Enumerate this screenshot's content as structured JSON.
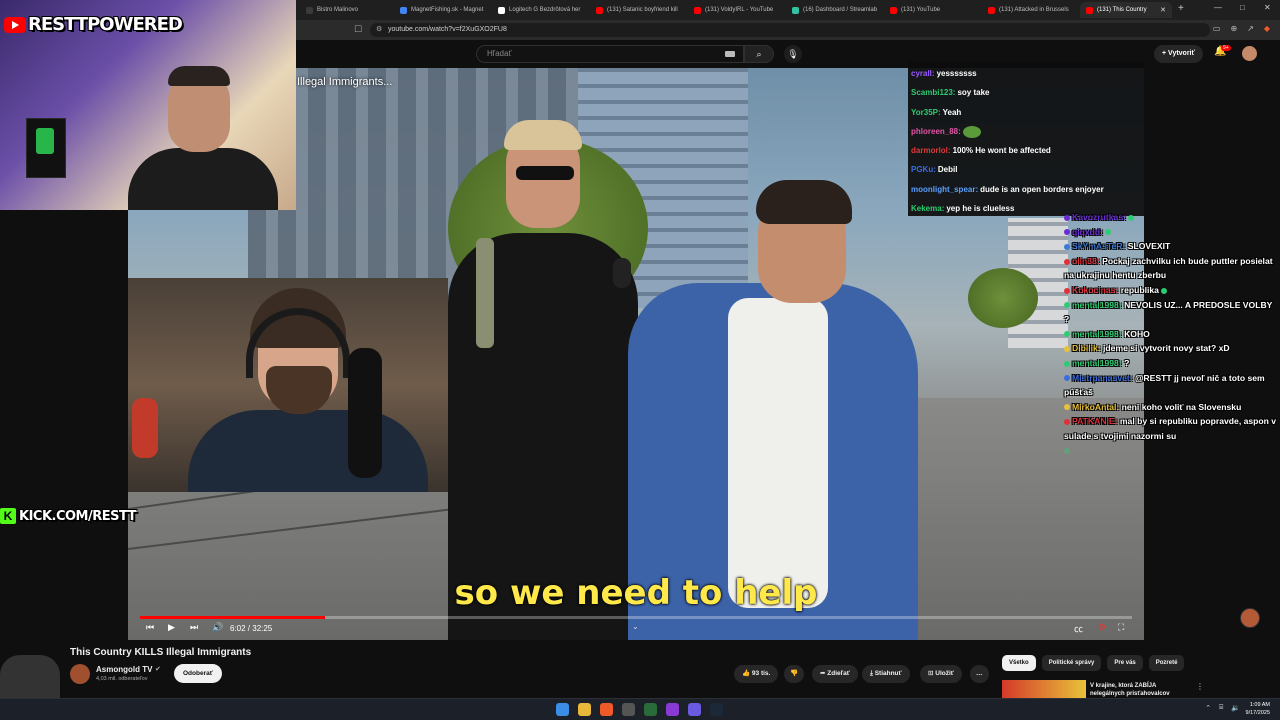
{
  "browser": {
    "tabs": [
      {
        "label": "Bistro Malinovo",
        "color": "#3a3a3a"
      },
      {
        "label": "MagnetFishing.sk - Magnet",
        "color": "#4285f4"
      },
      {
        "label": "Logitech G Bezdrôtová her",
        "color": "#ffffff"
      },
      {
        "label": "(131) Satanic boyfriend kill",
        "color": "#ff0000"
      },
      {
        "label": "(131) VoldyIRL - YouTube",
        "color": "#ff0000"
      },
      {
        "label": "(16) Dashboard / Streamlab",
        "color": "#31c3a2"
      },
      {
        "label": "(131) YouTube",
        "color": "#ff0000"
      },
      {
        "label": "(131) Attacked in Brussels",
        "color": "#ff0000"
      },
      {
        "label": "(131) This Country",
        "color": "#ff0000"
      }
    ],
    "url": "youtube.com/watch?v=f2XuGXO2FU8",
    "new_tab": "+",
    "min": "—",
    "max": "□",
    "close": "✕"
  },
  "youtube": {
    "search_placeholder": "Hľadať",
    "create_label": "+ Vytvoriť",
    "notif_count": "9+"
  },
  "video": {
    "overlay_title": "Illegal Immigrants...",
    "subtitle": "so we need to help",
    "time_current": "6:02",
    "time_total": "32:25",
    "time_display": "6:02 / 32:25",
    "progress": 0.186
  },
  "stream": {
    "brand_top": "RESTTPOWERED",
    "brand_kick": "KICK.COM/RESTT",
    "kick_letter": "K"
  },
  "chat_overlay_1": [
    {
      "user": "cyrall:",
      "color": "#9b59ff",
      "msg": "yesssssss"
    },
    {
      "user": "Scambi123:",
      "color": "#2ecc71",
      "msg": "soy take"
    },
    {
      "user": "Yor35P:",
      "color": "#2ecc71",
      "msg": "Yeah"
    },
    {
      "user": "phloreen_88:",
      "color": "#e056a8",
      "msg": "",
      "emote": true
    },
    {
      "user": "darmorlol:",
      "color": "#e03a3a",
      "msg": "100% He wont be affected"
    },
    {
      "user": "PGKu:",
      "color": "#3a6de0",
      "msg": "Debil"
    },
    {
      "user": "moonlight_spear:",
      "color": "#5aa0ff",
      "msg": "dude is an open borders enjoyer"
    },
    {
      "user": "Kekema:",
      "color": "#2ecc71",
      "msg": "yep he is clueless"
    }
  ],
  "chat_overlay_2": [
    {
      "user": "Kavozrutkas:",
      "color": "#6a2bd4",
      "msg": ""
    },
    {
      "user": "qiqxdd:",
      "color": "#6a2bd4",
      "msg": ""
    },
    {
      "user": "SkYmAsTeR:",
      "color": "#3a7bd4",
      "msg": "SLOVEXIT"
    },
    {
      "user": "olin38:",
      "color": "#e0303a",
      "msg": "Pockaj zachvilku ich bude puttler posielat na ukrajinu hentu zberbu"
    },
    {
      "user": "Kokocinas:",
      "color": "#e0303a",
      "msg": "republika"
    },
    {
      "user": "mental1998:",
      "color": "#2ecc71",
      "msg": "NEVOLIS UZ... A PREDOSLE VOLBY ?"
    },
    {
      "user": "mental1998:",
      "color": "#2ecc71",
      "msg": "KOHO"
    },
    {
      "user": "Dibilik:",
      "color": "#e8c23a",
      "msg": "jdeme si vytvorit novy stat? xD"
    },
    {
      "user": "mental1998:",
      "color": "#2ecc71",
      "msg": "?"
    },
    {
      "user": "Mistrpanasvet:",
      "color": "#3a6de0",
      "msg": "@RESTT jj nevoľ nič a toto sem púšťaš"
    },
    {
      "user": "MirkoAntal:",
      "color": "#e8c23a",
      "msg": "neni koho voliť na Slovensku"
    },
    {
      "user": "PATKANIE:",
      "color": "#e0303a",
      "msg": "mal by si republiku popravde, aspon v sulade s tvojimi nazormi su"
    },
    {
      "user": "",
      "color": "#2ecc71",
      "msg": ""
    }
  ],
  "below": {
    "video_title": "This Country KILLS Illegal Immigrants",
    "channel": "Asmongold TV",
    "subscribers": "4,03 mil. odberateľov",
    "subscribe_label": "Odoberať",
    "likes": "93 tis.",
    "share_label": "Zdieľať",
    "download_label": "Stiahnuť",
    "save_label": "Uložiť",
    "more": "…",
    "chips": [
      "Všetko",
      "Politické správy",
      "Pre vás",
      "Pozreté"
    ],
    "rec_title": "V krajine, ktorá ZABÍJA nelegálnych prisťahovalcov"
  },
  "taskbar": {
    "time": "1:09 AM",
    "date": "9/17/2025"
  }
}
